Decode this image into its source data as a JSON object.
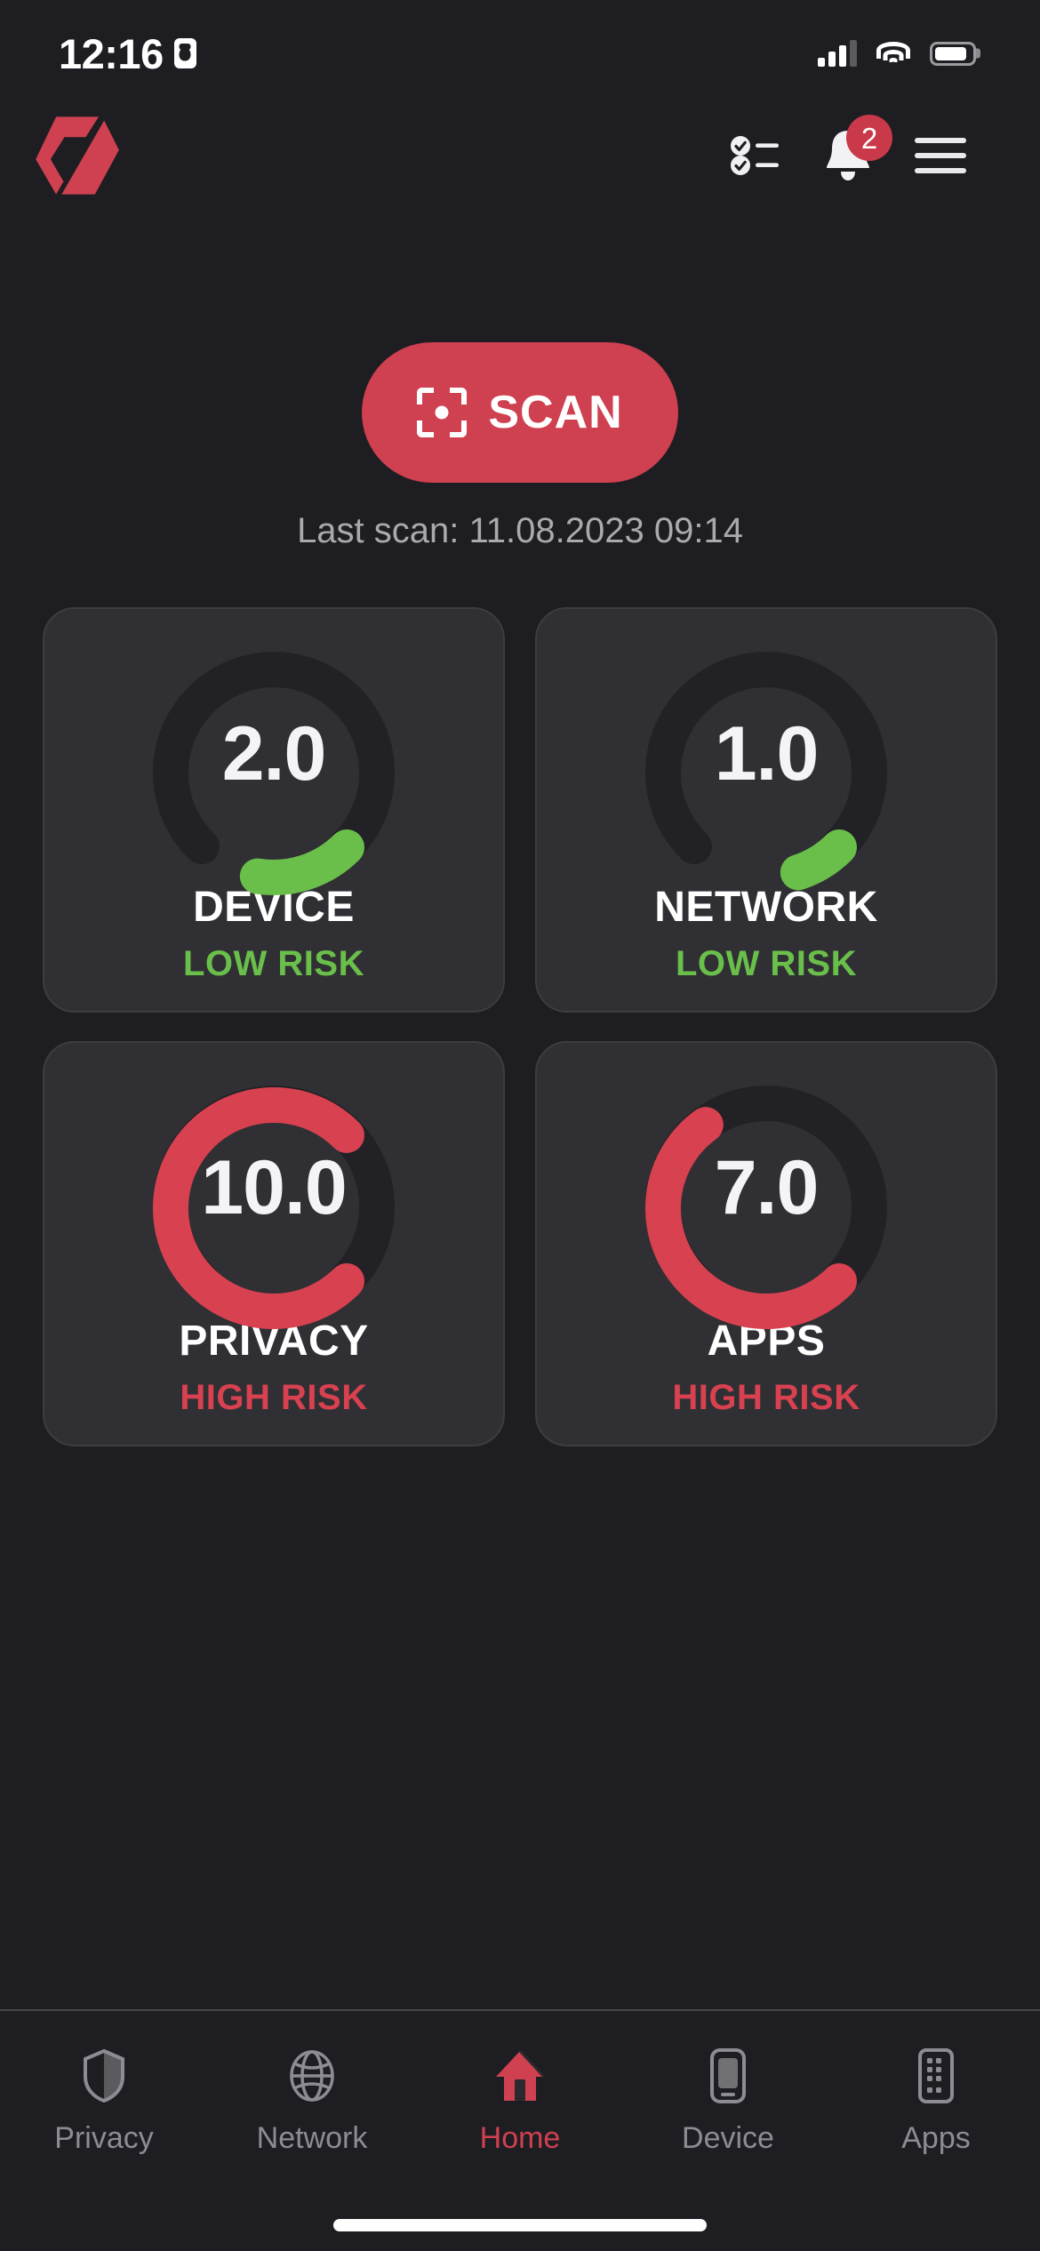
{
  "status_bar": {
    "time": "12:16",
    "recording_indicator": "screen-record-icon",
    "signal_icon": "cellular-signal-icon",
    "wifi_icon": "wifi-icon",
    "battery_icon": "battery-icon"
  },
  "header": {
    "logo": "app-logo",
    "checklist_icon": "checklist-icon",
    "notifications_icon": "bell-icon",
    "notifications_count": "2",
    "menu_icon": "hamburger-menu-icon"
  },
  "scan": {
    "icon": "scan-frame-icon",
    "label": "SCAN",
    "last_scan": "Last scan: 11.08.2023 09:14"
  },
  "colors": {
    "accent_red": "#cf4050",
    "risk_low": "#6ABF4B",
    "risk_high": "#d8414f",
    "page_bg": "#1e1e22",
    "card_bg": "#303034",
    "gauge_track": "#222226"
  },
  "chart_data": {
    "type": "gauge",
    "title": "Security risk scores",
    "scale_min": 0,
    "scale_max": 10,
    "sweep_degrees": 270,
    "gauges": [
      {
        "name": "DEVICE",
        "value": "2.0",
        "numeric": 2.0,
        "risk": "LOW RISK",
        "color": "#6ABF4B"
      },
      {
        "name": "NETWORK",
        "value": "1.0",
        "numeric": 1.0,
        "risk": "LOW RISK",
        "color": "#6ABF4B"
      },
      {
        "name": "PRIVACY",
        "value": "10.0",
        "numeric": 10.0,
        "risk": "HIGH RISK",
        "color": "#d8414f"
      },
      {
        "name": "APPS",
        "value": "7.0",
        "numeric": 7.0,
        "risk": "HIGH RISK",
        "color": "#d8414f"
      }
    ]
  },
  "tabbar": {
    "items": [
      {
        "label": "Privacy",
        "icon": "shield-icon",
        "active": false
      },
      {
        "label": "Network",
        "icon": "globe-icon",
        "active": false
      },
      {
        "label": "Home",
        "icon": "house-icon",
        "active": true
      },
      {
        "label": "Device",
        "icon": "phone-icon",
        "active": false
      },
      {
        "label": "Apps",
        "icon": "apps-grid-icon",
        "active": false
      }
    ]
  }
}
